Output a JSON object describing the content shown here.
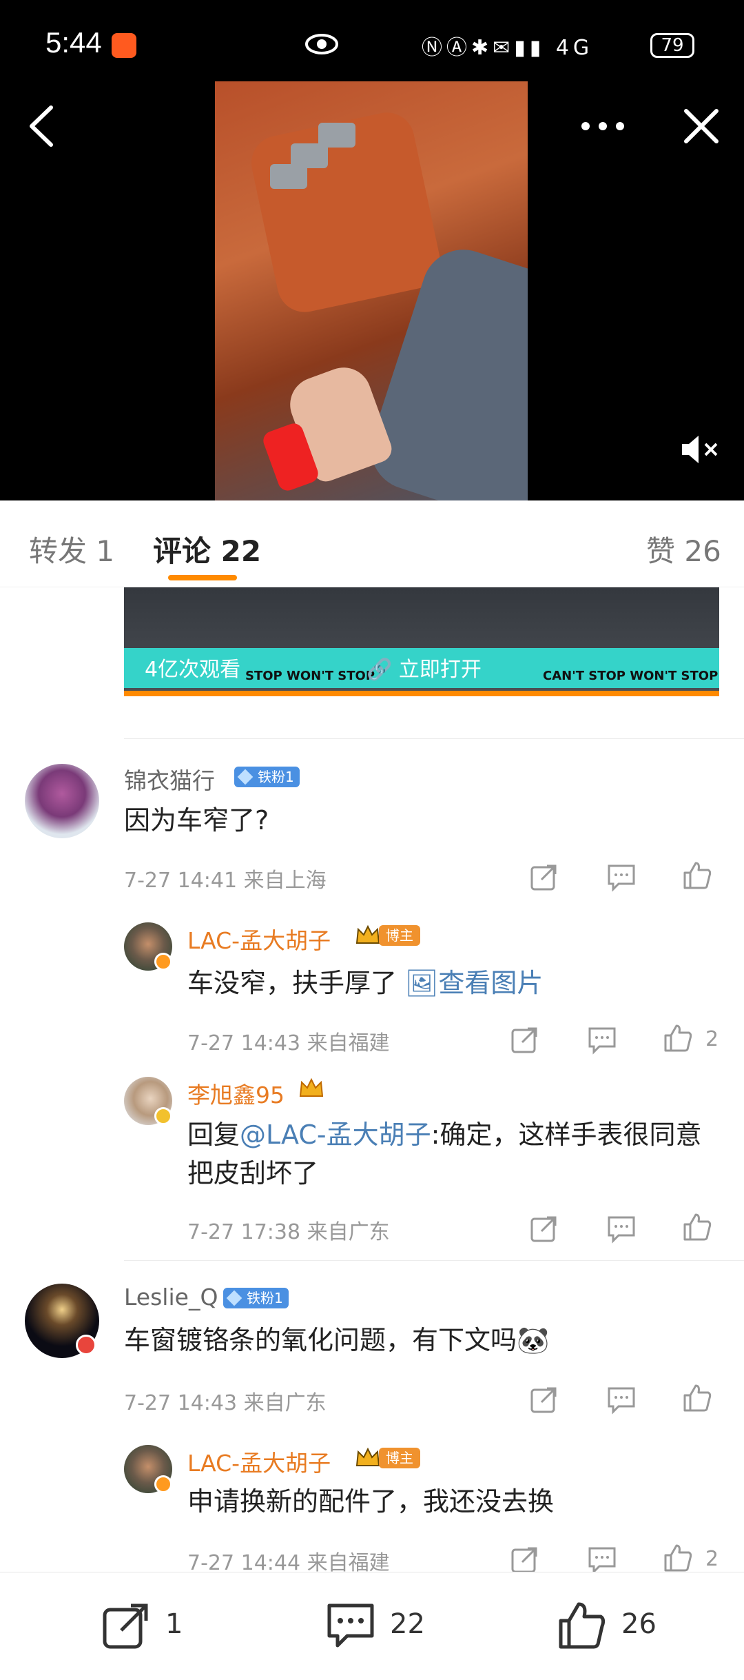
{
  "status_bar": {
    "time": "5:44",
    "battery": "79",
    "network": "4G"
  },
  "tabs": {
    "repost": "转发 1",
    "comments": "评论 22",
    "likes": "赞 26"
  },
  "ad_banner": {
    "views_text": "4亿次观看",
    "open_link": "立即打开",
    "slogan_1": "STOP WON'T STOP",
    "slogan_2": "CAN'T STOP WON'T STOP"
  },
  "comments": [
    {
      "user": "锦衣猫行",
      "badge": "铁粉1",
      "text": "因为车窄了?",
      "meta": "7-27 14:41  来自上海",
      "replies": [
        {
          "user": "LAC-孟大胡子",
          "badge": "博主",
          "text": "车没窄，扶手厚了",
          "link": "查看图片",
          "meta": "7-27 14:43  来自福建",
          "likes": "2"
        },
        {
          "user": "李旭鑫95",
          "reply_prefix": "回复",
          "mention": "@LAC-孟大胡子",
          "text": ":确定，这样手表很同意把皮刮坏了",
          "meta": "7-27 17:38  来自广东"
        }
      ]
    },
    {
      "user": "Leslie_Q",
      "badge": "铁粉1",
      "text": "车窗镀铬条的氧化问题，有下文吗",
      "meta": "7-27 14:43  来自广东",
      "replies": [
        {
          "user": "LAC-孟大胡子",
          "badge": "博主",
          "text": "申请换新的配件了，我还没去换",
          "meta": "7-27 14:44  来自福建",
          "likes": "2"
        }
      ]
    }
  ],
  "bottom_bar": {
    "reposts": "1",
    "comments": "22",
    "likes": "26"
  },
  "colors": {
    "accent": "#ff8a00",
    "link": "#4a7fb5",
    "host_name": "#e87b22",
    "fan_badge": "#4a90e2"
  }
}
